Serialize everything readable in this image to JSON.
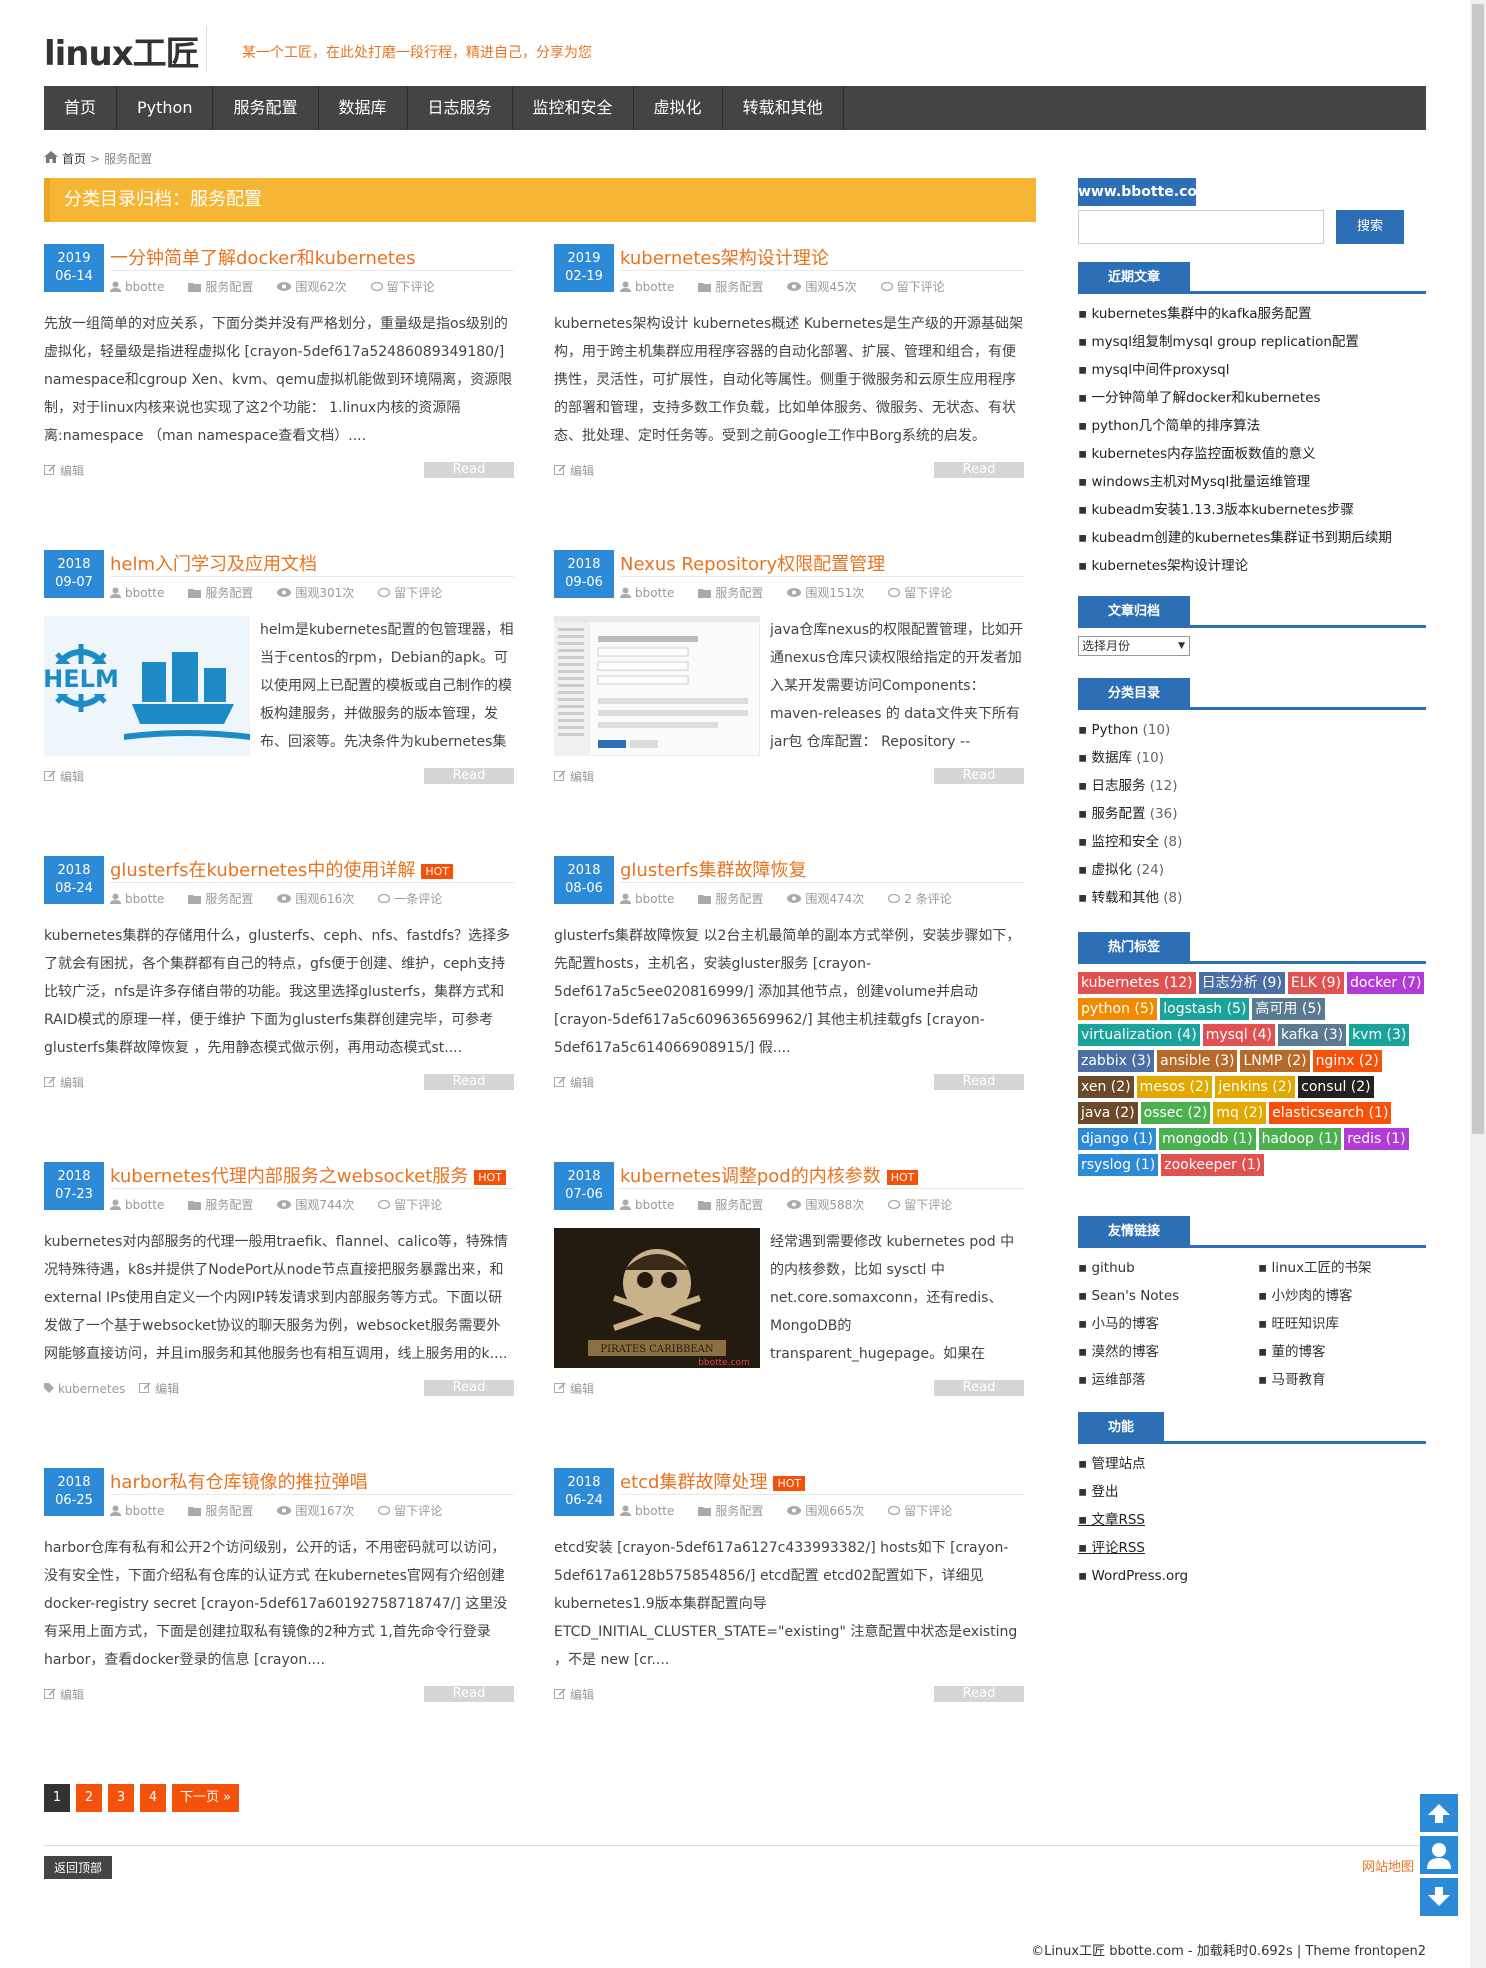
{
  "header": {
    "logo": "linux工匠",
    "tagline": "某一个工匠，在此处打磨一段行程，精进自己，分享为您"
  },
  "nav": [
    "首页",
    "Python",
    "服务配置",
    "数据库",
    "日志服务",
    "监控和安全",
    "虚拟化",
    "转载和其他"
  ],
  "breadcrumb": {
    "home": "首页",
    "sep": ">",
    "current": "服务配置"
  },
  "category_title": "分类目录归档：服务配置",
  "posts": [
    {
      "year": "2019",
      "md": "06-14",
      "title": "一分钟简单了解docker和kubernetes",
      "hot": "",
      "author": "bbotte",
      "cat": "服务配置",
      "views": "围观62次",
      "comments": "留下评论",
      "excerpt": "先放一组简单的对应关系，下面分类并没有严格划分，重量级是指os级别的虚拟化，轻量级是指进程虚拟化 [crayon-5def617a52486089349180/] namespace和cgroup Xen、kvm、qemu虚拟机能做到环境隔离，资源限制，对于linux内核来说也实现了这2个功能： 1.linux内核的资源隔离:namespace （man namespace查看文档）....",
      "tag": "",
      "edit": "编辑",
      "read": "Read"
    },
    {
      "year": "2019",
      "md": "02-19",
      "title": "kubernetes架构设计理论",
      "hot": "",
      "author": "bbotte",
      "cat": "服务配置",
      "views": "围观45次",
      "comments": "留下评论",
      "excerpt": "kubernetes架构设计 kubernetes概述 Kubernetes是生产级的开源基础架构，用于跨主机集群应用程序容器的自动化部署、扩展、管理和组合，有便携性，灵活性，可扩展性，自动化等属性。侧重于微服务和云原生应用程序的部署和管理，支持多数工作负载，比如单体服务、微服务、无状态、有状态、批处理、定时任务等。受到之前Google工作中Borg系统的启发。",
      "tag": "",
      "edit": "编辑",
      "read": "Read"
    },
    {
      "year": "2018",
      "md": "09-07",
      "title": "helm入门学习及应用文档",
      "hot": "",
      "author": "bbotte",
      "cat": "服务配置",
      "views": "围观301次",
      "comments": "留下评论",
      "excerpt": "helm是kubernetes配置的包管理器，相当于centos的rpm，Debian的apk。可以使用网上已配置的模板或自己制作的模板构建服务，并做服务的版本管理，发布、回滚等。先决条件为kubernetes集",
      "tag": "",
      "edit": "编辑",
      "read": "Read",
      "img": "helm"
    },
    {
      "year": "2018",
      "md": "09-06",
      "title": "Nexus Repository权限配置管理",
      "hot": "",
      "author": "bbotte",
      "cat": "服务配置",
      "views": "围观151次",
      "comments": "留下评论",
      "excerpt": "java仓库nexus的权限配置管理，比如开通nexus仓库只读权限给指定的开发者加入某开发需要访问Components：maven-releases 的 data文件夹下所有jar包 仓库配置： Repository --",
      "tag": "",
      "edit": "编辑",
      "read": "Read",
      "img": "nexus"
    },
    {
      "year": "2018",
      "md": "08-24",
      "title": "glusterfs在kubernetes中的使用详解",
      "hot": "HOT",
      "author": "bbotte",
      "cat": "服务配置",
      "views": "围观616次",
      "comments": "一条评论",
      "excerpt": "kubernetes集群的存储用什么，glusterfs、ceph、nfs、fastdfs？选择多了就会有困扰，各个集群都有自己的特点，gfs便于创建、维护，ceph支持比较广泛，nfs是许多存储自带的功能。我这里选择glusterfs，集群方式和RAID模式的原理一样，便于维护 下面为glusterfs集群创建完毕，可参考glusterfs集群故障恢复 ，先用静态模式做示例，再用动态模式st....",
      "tag": "",
      "edit": "编辑",
      "read": "Read"
    },
    {
      "year": "2018",
      "md": "08-06",
      "title": "glusterfs集群故障恢复",
      "hot": "",
      "author": "bbotte",
      "cat": "服务配置",
      "views": "围观474次",
      "comments": "2 条评论",
      "excerpt": "glusterfs集群故障恢复 以2台主机最简单的副本方式举例，安装步骤如下，先配置hosts，主机名，安装gluster服务 [crayon-5def617a5c5ee020816999/] 添加其他节点，创建volume并启动 [crayon-5def617a5c609636569962/] 其他主机挂载gfs [crayon-5def617a5c614066908915/] 假....",
      "tag": "",
      "edit": "编辑",
      "read": "Read"
    },
    {
      "year": "2018",
      "md": "07-23",
      "title": "kubernetes代理内部服务之websocket服务",
      "hot": "HOT",
      "author": "bbotte",
      "cat": "服务配置",
      "views": "围观744次",
      "comments": "留下评论",
      "excerpt": "kubernetes对内部服务的代理一般用traefik、flannel、calico等，特殊情况特殊待遇，k8s并提供了NodePort从node节点直接把服务暴露出来，和external IPs使用自定义一个内网IP转发请求到内部服务等方式。下面以研发做了一个基于websocket协议的聊天服务为例，websocket服务需要外网能够直接访问，并且im服务和其他服务也有相互调用，线上服务用的k....",
      "tag": "kubernetes",
      "edit": "编辑",
      "read": "Read"
    },
    {
      "year": "2018",
      "md": "07-06",
      "title": "kubernetes调整pod的内核参数",
      "hot": "HOT",
      "author": "bbotte",
      "cat": "服务配置",
      "views": "围观588次",
      "comments": "留下评论",
      "excerpt": "经常遇到需要修改 kubernetes pod 中的内核参数，比如 sysctl 中net.core.somaxconn，还有redis、MongoDB的transparent_hugepage。如果在",
      "tag": "",
      "edit": "编辑",
      "read": "Read",
      "img": "pirates",
      "img_text": "PIRATES CARIBBEAN",
      "img_wm": "bbotte.com"
    },
    {
      "year": "2018",
      "md": "06-25",
      "title": "harbor私有仓库镜像的推拉弹唱",
      "hot": "",
      "author": "bbotte",
      "cat": "服务配置",
      "views": "围观167次",
      "comments": "留下评论",
      "excerpt": "harbor仓库有私有和公开2个访问级别，公开的话，不用密码就可以访问，没有安全性，下面介绍私有仓库的认证方式 在kubernetes官网有介绍创建docker-registry secret [crayon-5def617a60192758718747/] 这里没有采用上面方式，下面是创建拉取私有镜像的2种方式 1,首先命令行登录harbor，查看docker登录的信息 [crayon....",
      "tag": "",
      "edit": "编辑",
      "read": "Read"
    },
    {
      "year": "2018",
      "md": "06-24",
      "title": "etcd集群故障处理",
      "hot": "HOT",
      "author": "bbotte",
      "cat": "服务配置",
      "views": "围观665次",
      "comments": "留下评论",
      "excerpt": "etcd安装 [crayon-5def617a6127c433993382/] hosts如下 [crayon-5def617a6128b575854856/] etcd配置 etcd02配置如下，详细见kubernetes1.9版本集群配置向导 ETCD_INITIAL_CLUSTER_STATE=\"existing\" 注意配置中状态是existing ，不是 new [cr....",
      "tag": "",
      "edit": "编辑",
      "read": "Read"
    }
  ],
  "pager": [
    "1",
    "2",
    "3",
    "4",
    "下一页 »"
  ],
  "footer": {
    "backtop": "返回顶部",
    "sitemap": "网站地图",
    "copyright": "©Linux工匠 bbotte.com - 加载耗时0.692s | Theme frontopen2"
  },
  "sidebar": {
    "banner": "www.bbotte.com",
    "search_btn": "搜索",
    "recent_title": "近期文章",
    "recent": [
      "kubernetes集群中的kafka服务配置",
      "mysql组复制mysql group replication配置",
      "mysql中间件proxysql",
      "一分钟简单了解docker和kubernetes",
      "python几个简单的排序算法",
      "kubernetes内存监控面板数值的意义",
      "windows主机对Mysql批量运维管理",
      "kubeadm安装1.13.3版本kubernetes步骤",
      "kubeadm创建的kubernetes集群证书到期后续期",
      "kubernetes架构设计理论"
    ],
    "archive_title": "文章归档",
    "archive_select": "选择月份",
    "cat_title": "分类目录",
    "cats": [
      {
        "name": "Python",
        "n": "(10)"
      },
      {
        "name": "数据库",
        "n": "(10)"
      },
      {
        "name": "日志服务",
        "n": "(12)"
      },
      {
        "name": "服务配置",
        "n": "(36)"
      },
      {
        "name": "监控和安全",
        "n": "(8)"
      },
      {
        "name": "虚拟化",
        "n": "(24)"
      },
      {
        "name": "转载和其他",
        "n": "(8)"
      }
    ],
    "tags_title": "热门标签",
    "tags": [
      {
        "t": "kubernetes (12)",
        "c": "#e05252"
      },
      {
        "t": "日志分析 (9)",
        "c": "#4a6fa5"
      },
      {
        "t": "ELK (9)",
        "c": "#e05252"
      },
      {
        "t": "docker (7)",
        "c": "#b23bd6"
      },
      {
        "t": "python (5)",
        "c": "#f08a00"
      },
      {
        "t": "logstash (5)",
        "c": "#1aa39a"
      },
      {
        "t": "高可用 (5)",
        "c": "#5a7a90"
      },
      {
        "t": "virtualization (4)",
        "c": "#1aa39a"
      },
      {
        "t": "mysql (4)",
        "c": "#e05252"
      },
      {
        "t": "kafka (3)",
        "c": "#5a7a90"
      },
      {
        "t": "kvm (3)",
        "c": "#1aa39a"
      },
      {
        "t": "zabbix (3)",
        "c": "#4a6fa5"
      },
      {
        "t": "ansible (3)",
        "c": "#b56a2a"
      },
      {
        "t": "LNMP (2)",
        "c": "#b56a2a"
      },
      {
        "t": "nginx (2)",
        "c": "#f4510b"
      },
      {
        "t": "xen (2)",
        "c": "#6b4a2a"
      },
      {
        "t": "mesos (2)",
        "c": "#e0a800"
      },
      {
        "t": "jenkins (2)",
        "c": "#e0a800"
      },
      {
        "t": "consul (2)",
        "c": "#222222"
      },
      {
        "t": "java (2)",
        "c": "#6b4a2a"
      },
      {
        "t": "ossec (2)",
        "c": "#4caf50"
      },
      {
        "t": "mq (2)",
        "c": "#e0a800"
      },
      {
        "t": "elasticsearch (1)",
        "c": "#f4510b"
      },
      {
        "t": "django (1)",
        "c": "#2d8ad6"
      },
      {
        "t": "mongodb (1)",
        "c": "#4caf50"
      },
      {
        "t": "hadoop (1)",
        "c": "#4caf50"
      },
      {
        "t": "redis (1)",
        "c": "#b23bd6"
      },
      {
        "t": "rsyslog (1)",
        "c": "#2d8ad6"
      },
      {
        "t": "zookeeper (1)",
        "c": "#e05252"
      }
    ],
    "links_title": "友情链接",
    "links": [
      "github",
      "linux工匠的书架",
      "Sean's Notes",
      "小炒肉的博客",
      "小马的博客",
      "旺旺知识库",
      "漠然的博客",
      "董的博客",
      "运维部落",
      "马哥教育"
    ],
    "func_title": "功能",
    "func": [
      "管理站点",
      "登出",
      "文章RSS",
      "评论RSS",
      "WordPress.org"
    ]
  },
  "colors": {
    "accent": "#e8731e",
    "nav_bg": "#444444",
    "cat_bar": "#f5b535",
    "date_bg": "#2d8ad6",
    "widget": "#2d6fb4",
    "hot": "#f4510b"
  }
}
